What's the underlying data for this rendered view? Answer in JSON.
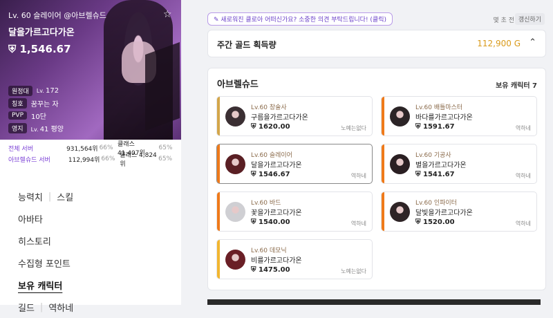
{
  "character": {
    "title": "Lv. 60 슬레이어 @아브렐슈드",
    "name": "달을가르고다가온",
    "power": "1,546.67",
    "stats": [
      {
        "key": "원정대",
        "lv": "Lv.",
        "value": "172"
      },
      {
        "key": "칭호",
        "lv": "",
        "value": "꿈꾸는 자"
      },
      {
        "key": "PVP",
        "lv": "",
        "value": "10단"
      },
      {
        "key": "영지",
        "lv": "Lv.",
        "value": "41 평양"
      }
    ],
    "ranks": [
      {
        "server": "전체 서버",
        "rank": "931,564위",
        "pct": "66%",
        "cls": "클래스 41,407위",
        "cls_pct": "65%"
      },
      {
        "server": "아브렐슈드 서버",
        "rank": "112,994위",
        "pct": "66%",
        "cls": "클래스 4,824위",
        "cls_pct": "65%"
      }
    ]
  },
  "menu": {
    "stat": "능력치",
    "skill": "스킬",
    "avatar": "아바타",
    "history": "히스토리",
    "collect": "수집형 포인트",
    "owned": "보유 캐릭터",
    "guild": "길드",
    "guild_name": "역하네"
  },
  "topbar": {
    "feedback": "새로워진 클로아 어떠신가요? 소중한 의견 부탁드립니다! (클릭)",
    "ago": "몇 초 전",
    "refresh": "갱신하기"
  },
  "gold": {
    "label": "주간 골드 획득량",
    "amount": "112,900 G"
  },
  "server": {
    "name": "아브렐슈드",
    "count_label": "보유 캐릭터 7"
  },
  "characters": [
    {
      "cls": "Lv.60 창술사",
      "name": "구름을가르고다가온",
      "power": "1620.00",
      "guild": "노예는없다",
      "bar": "#d3a64a",
      "avatar": "#3b2f33"
    },
    {
      "cls": "Lv.60 배틀마스터",
      "name": "바다를가르고다가온",
      "power": "1591.67",
      "guild": "역하네",
      "bar": "#ef7a1a",
      "avatar": "#2b2426"
    },
    {
      "cls": "Lv.60 슬레이어",
      "name": "달을가르고다가온",
      "power": "1546.67",
      "guild": "역하네",
      "bar": "#ef7a1a",
      "avatar": "#5a1f24"
    },
    {
      "cls": "Lv.60 기공사",
      "name": "별을가르고다가온",
      "power": "1541.67",
      "guild": "역하네",
      "bar": "#ef7a1a",
      "avatar": "#2a1f22"
    },
    {
      "cls": "Lv.60 바드",
      "name": "꽃을가르고다가온",
      "power": "1540.00",
      "guild": "역하네",
      "bar": "#ef7a1a",
      "avatar": "#cfcfd3"
    },
    {
      "cls": "Lv.60 인파이터",
      "name": "달빛을가르고다가온",
      "power": "1520.00",
      "guild": "역하네",
      "bar": "#ef7a1a",
      "avatar": "#2e2426"
    },
    {
      "cls": "Lv.60 데모닉",
      "name": "비를가르고다가온",
      "power": "1475.00",
      "guild": "노예는없다",
      "bar": "#f2b630",
      "avatar": "#6a1f26"
    }
  ]
}
